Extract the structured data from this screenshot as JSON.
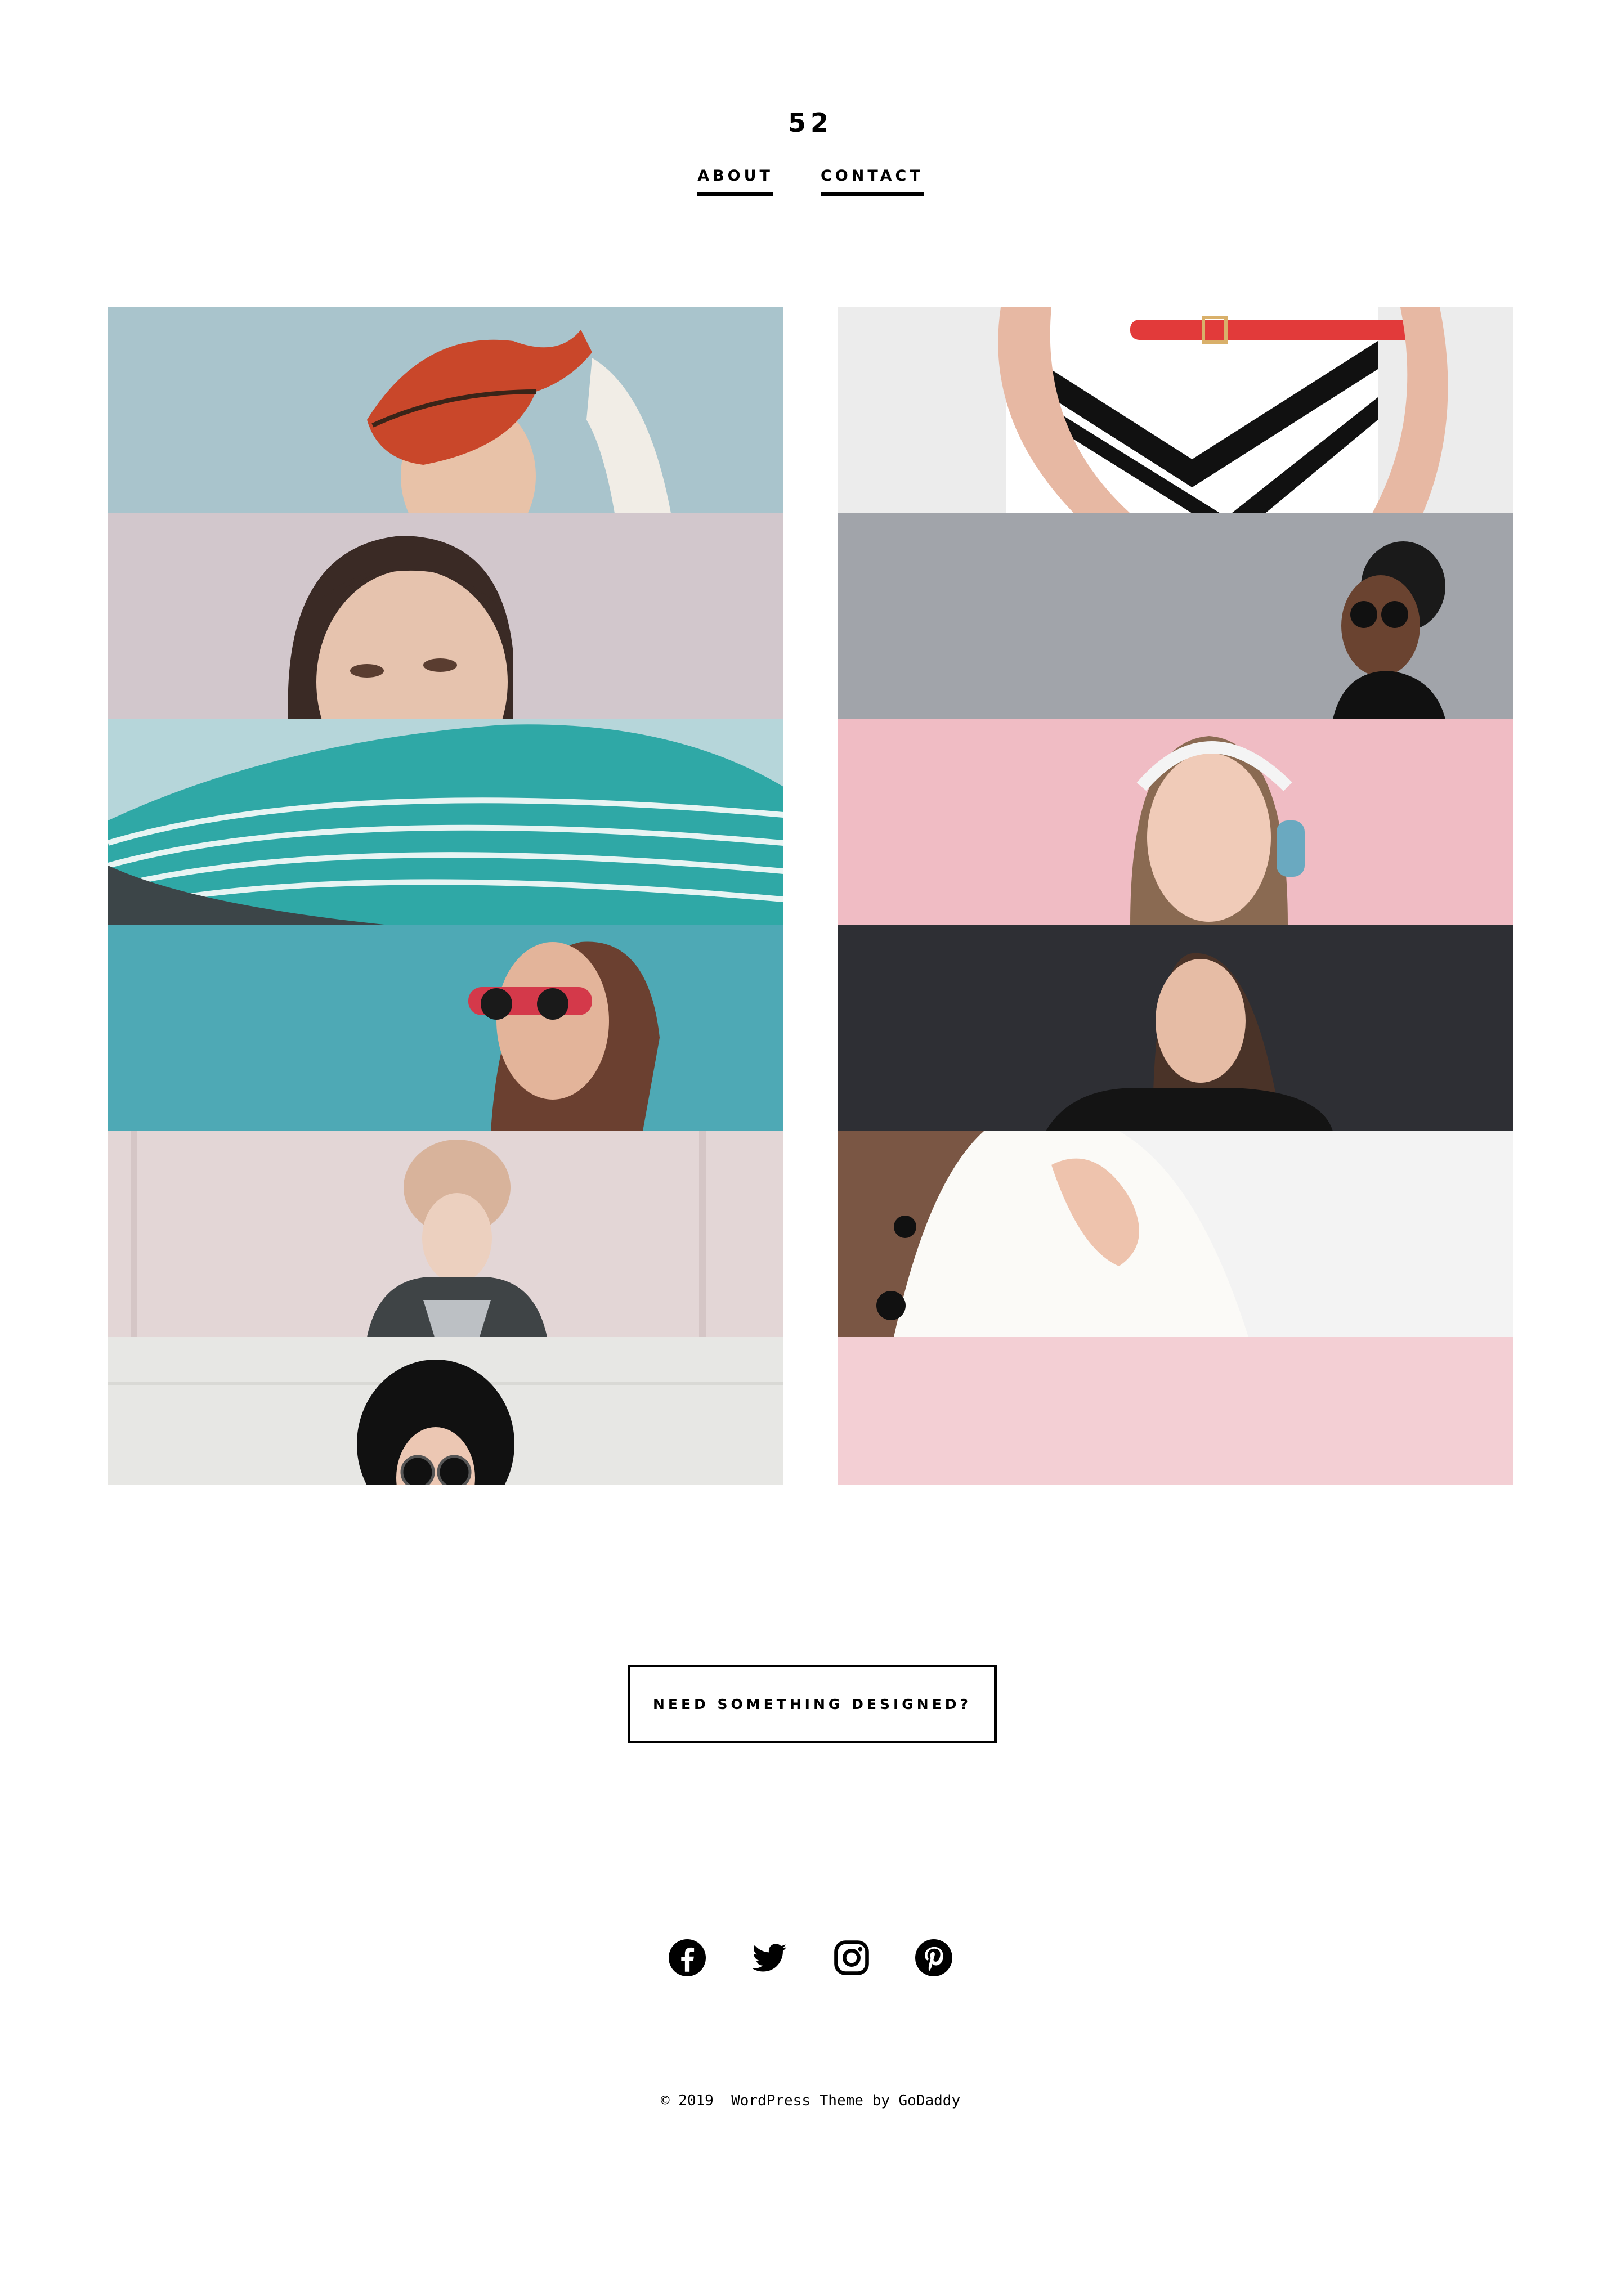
{
  "site": {
    "title": "52"
  },
  "nav": {
    "items": [
      {
        "label": "ABOUT"
      },
      {
        "label": "CONTACT"
      }
    ]
  },
  "gallery": {
    "left": [
      {
        "alt": "woman-red-hat",
        "bg": "#a9c4cc",
        "accent": "#c9472a"
      },
      {
        "alt": "woman-portrait",
        "bg": "#d2c7cc",
        "accent": "#3a2a25"
      },
      {
        "alt": "teal-striped-hat",
        "bg": "#b6d6da",
        "accent": "#2fa8a6"
      },
      {
        "alt": "woman-red-sunglasses",
        "bg": "#4ea9b5",
        "accent": "#d4394a"
      },
      {
        "alt": "woman-turban",
        "bg": "#e3d6d6",
        "accent": "#d8b39b"
      },
      {
        "alt": "woman-black-hat",
        "bg": "#e7e7e4",
        "accent": "#111111"
      }
    ],
    "right": [
      {
        "alt": "striped-dress-red-belt",
        "bg": "#ececec",
        "accent": "#111111"
      },
      {
        "alt": "woman-on-phone",
        "bg": "#a1a4aa",
        "accent": "#1a1a1a"
      },
      {
        "alt": "woman-headphones",
        "bg": "#f0bcc4",
        "accent": "#f4f4f4"
      },
      {
        "alt": "woman-dark-background",
        "bg": "#2e2f34",
        "accent": "#4a3328"
      },
      {
        "alt": "white-coat",
        "bg": "#f3f3f3",
        "accent": "#ffffff"
      },
      {
        "alt": "woman-pink-background",
        "bg": "#f3cfd4",
        "accent": "#2b1f1c"
      }
    ]
  },
  "cta": {
    "label": "NEED SOMETHING DESIGNED?"
  },
  "social": [
    {
      "name": "facebook-icon"
    },
    {
      "name": "twitter-icon"
    },
    {
      "name": "instagram-icon"
    },
    {
      "name": "pinterest-icon"
    }
  ],
  "footer": {
    "copyright": "© 2019",
    "credit": "WordPress Theme by GoDaddy"
  }
}
